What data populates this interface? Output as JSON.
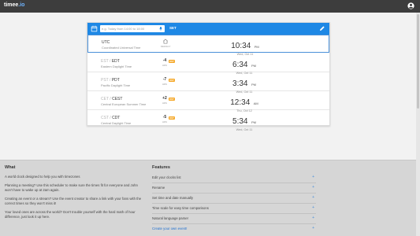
{
  "app": {
    "logo_main": "timee",
    "logo_suffix": ".io"
  },
  "input": {
    "placeholder": "e.g. Today from 14:00 to 18:00",
    "set_label": "SET"
  },
  "zones": [
    {
      "abbr": "UTC",
      "abbr_old": "",
      "name": "Coordinated Universal Time",
      "offset": "",
      "offset_sub": "DEFAULT",
      "home": true,
      "dst": false,
      "time": "10:34",
      "ampm": "PM",
      "date": "Wed, Oct 11"
    },
    {
      "abbr": "EDT",
      "abbr_old": "EST / ",
      "name": "Eastern Daylight Time",
      "offset": "-4",
      "offset_sub": "HRS",
      "home": false,
      "dst": true,
      "time": "6:34",
      "ampm": "PM",
      "date": "Wed, Oct 11"
    },
    {
      "abbr": "PDT",
      "abbr_old": "PST / ",
      "name": "Pacific Daylight Time",
      "offset": "-7",
      "offset_sub": "HRS",
      "home": false,
      "dst": true,
      "time": "3:34",
      "ampm": "PM",
      "date": "Wed, Oct 11"
    },
    {
      "abbr": "CEST",
      "abbr_old": "CET / ",
      "name": "Central European Summer Time",
      "offset": "+2",
      "offset_sub": "HRS",
      "home": false,
      "dst": true,
      "time": "12:34",
      "ampm": "AM",
      "date": "Thu, Oct 12"
    },
    {
      "abbr": "CDT",
      "abbr_old": "CST / ",
      "name": "Central Daylight Time",
      "offset": "-5",
      "offset_sub": "HRS",
      "home": false,
      "dst": true,
      "time": "5:34",
      "ampm": "PM",
      "date": "Wed, Oct 11"
    }
  ],
  "dst_badge": "DST",
  "footer": {
    "what_heading": "What",
    "what_subtitle": "A world clock designed to help you with timezones",
    "what_paragraphs": [
      "Planning a meeting? Use this scheduler to make sure the times fit for everyone and John won't have to wake up at 2am again.",
      "Creating an event or a stream? Use the event creator to share a link with your fans with the correct times so they won't miss it!",
      "Your loved ones are across the world? Don't trouble yourself with the hard math of hour difference, just look it up here."
    ],
    "features_heading": "Features",
    "features": [
      {
        "label": "Edit your clocks list",
        "link": false
      },
      {
        "label": "Rename",
        "link": false
      },
      {
        "label": "Set time and date manually",
        "link": false
      },
      {
        "label": "Time scale for easy time comparisons",
        "link": false
      },
      {
        "label": "Natural language parser",
        "link": false
      },
      {
        "label": "Create your own event!",
        "link": true
      }
    ],
    "plus": "+"
  },
  "colors": {
    "accent": "#1e88e5",
    "topbar": "#3d3d3d",
    "dst_badge": "#f5a623",
    "link": "#1e6fd0"
  },
  "icons": [
    "calendar-icon",
    "mic-icon",
    "pencil-icon",
    "home-icon",
    "account-icon"
  ]
}
